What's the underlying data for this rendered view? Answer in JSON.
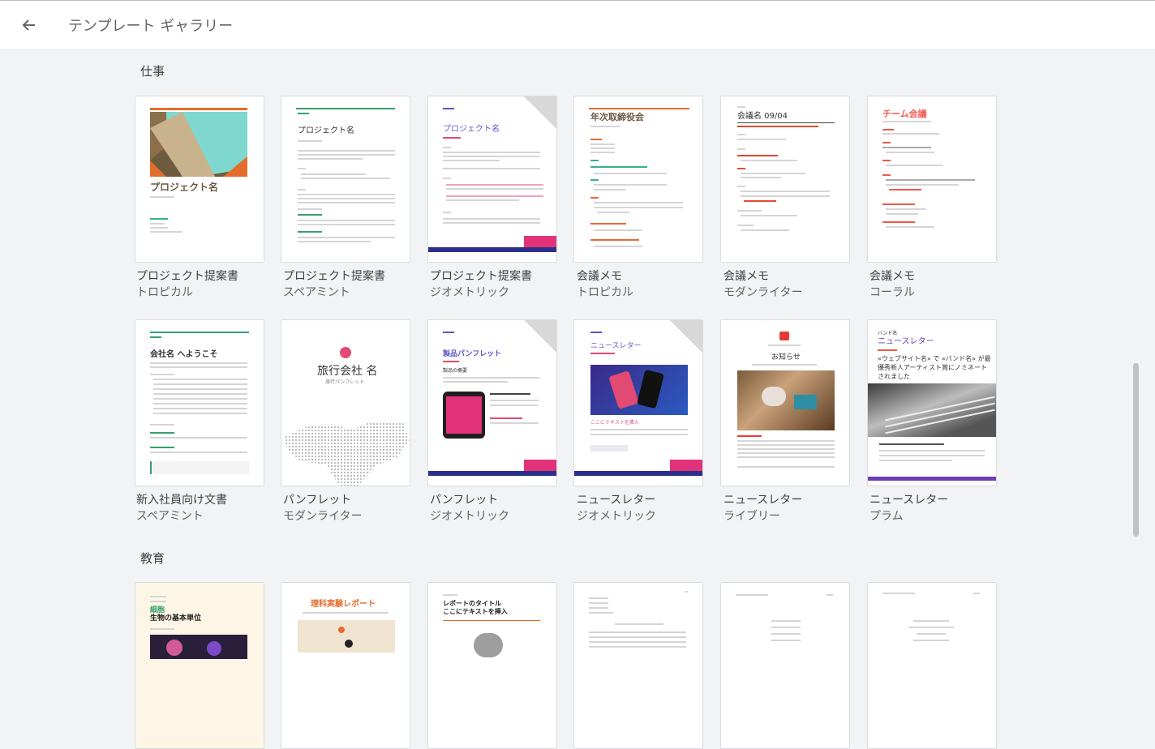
{
  "header": {
    "title": "テンプレート ギャラリー",
    "back_icon": "arrow-left-icon"
  },
  "sections": [
    {
      "title": "仕事"
    },
    {
      "title": "教育"
    }
  ],
  "templates": [
    {
      "name": "プロジェクト提案書",
      "style": "トロピカル",
      "thumb_title": "プロジェクト名",
      "accent": "#6b5a44"
    },
    {
      "name": "プロジェクト提案書",
      "style": "スペアミント",
      "thumb_title": "プロジェクト名",
      "accent": "#35a06e"
    },
    {
      "name": "プロジェクト提案書",
      "style": "ジオメトリック",
      "thumb_title": "プロジェクト名",
      "accent": "#5a55c8"
    },
    {
      "name": "会議メモ",
      "style": "トロピカル",
      "thumb_title": "年次取締役会",
      "accent": "#6b5a44"
    },
    {
      "name": "会議メモ",
      "style": "モダンライター",
      "thumb_title": "会議名 09/04",
      "accent": "#e24a2f"
    },
    {
      "name": "会議メモ",
      "style": "コーラル",
      "thumb_title": "チーム会議",
      "accent": "#f2584a"
    },
    {
      "name": "新入社員向け文書",
      "style": "スペアミント",
      "thumb_title": "会社名 へようこそ",
      "accent": "#35a06e"
    },
    {
      "name": "パンフレット",
      "style": "モダンライター",
      "thumb_title": "旅行会社 名",
      "thumb_sub": "旅行パンフレット",
      "accent": "#e24a74"
    },
    {
      "name": "パンフレット",
      "style": "ジオメトリック",
      "thumb_title": "製品パンフレット",
      "thumb_sub": "製品の概要",
      "accent": "#5a55c8"
    },
    {
      "name": "ニュースレター",
      "style": "ジオメトリック",
      "thumb_title": "ニュースレター",
      "thumb_sub": "ここにテキストを挿入",
      "accent": "#5a55c8"
    },
    {
      "name": "ニュースレター",
      "style": "ライブリー",
      "thumb_title": "お知らせ",
      "accent": "#e53935"
    },
    {
      "name": "ニュースレター",
      "style": "プラム",
      "thumb_title": "ニュースレター",
      "thumb_kicker": "バンド名",
      "thumb_body": "«ウェブサイト名» で «バンド名» が最優秀新人アーティスト賞にノミネートされました",
      "accent": "#6a3fb5"
    }
  ],
  "education": [
    {
      "thumb_kicker": "細胞",
      "thumb_title": "生物の基本単位"
    },
    {
      "thumb_title": "理科実験レポート"
    },
    {
      "thumb_title": "レポートのタイトル",
      "thumb_sub": "ここにテキストを挿入"
    },
    {
      "thumb_title": ""
    },
    {
      "thumb_title": ""
    },
    {
      "thumb_title": ""
    }
  ]
}
